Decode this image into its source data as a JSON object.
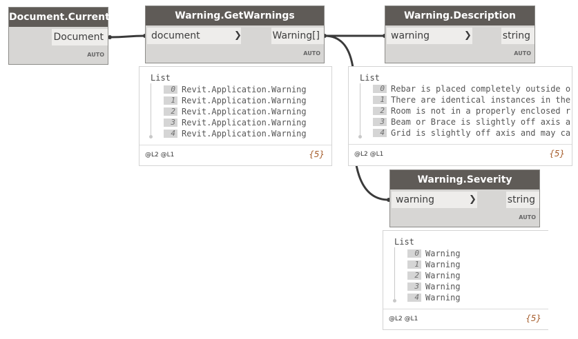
{
  "nodes": {
    "document_current": {
      "title": "Document.Current",
      "output": "Document",
      "lacing": "AUTO"
    },
    "get_warnings": {
      "title": "Warning.GetWarnings",
      "input": "document",
      "output": "Warning[]",
      "lacing": "AUTO"
    },
    "description": {
      "title": "Warning.Description",
      "input": "warning",
      "output": "string",
      "lacing": "AUTO"
    },
    "severity": {
      "title": "Warning.Severity",
      "input": "warning",
      "output": "string",
      "lacing": "AUTO"
    }
  },
  "previews": {
    "get_warnings": {
      "title": "List",
      "items": [
        {
          "index": "0",
          "value": "Revit.Application.Warning"
        },
        {
          "index": "1",
          "value": "Revit.Application.Warning"
        },
        {
          "index": "2",
          "value": "Revit.Application.Warning"
        },
        {
          "index": "3",
          "value": "Revit.Application.Warning"
        },
        {
          "index": "4",
          "value": "Revit.Application.Warning"
        }
      ],
      "levels": "@L2 @L1",
      "count": "{5}"
    },
    "description": {
      "title": "List",
      "items": [
        {
          "index": "0",
          "value": "Rebar is placed completely outside o"
        },
        {
          "index": "1",
          "value": "There are identical instances in the"
        },
        {
          "index": "2",
          "value": "Room is not in a properly enclosed r"
        },
        {
          "index": "3",
          "value": "Beam or Brace is slightly off axis a"
        },
        {
          "index": "4",
          "value": "Grid is slightly off axis and may ca"
        }
      ],
      "levels": "@L2 @L1",
      "count": "{5}"
    },
    "severity": {
      "title": "List",
      "items": [
        {
          "index": "0",
          "value": "Warning"
        },
        {
          "index": "1",
          "value": "Warning"
        },
        {
          "index": "2",
          "value": "Warning"
        },
        {
          "index": "3",
          "value": "Warning"
        },
        {
          "index": "4",
          "value": "Warning"
        }
      ],
      "levels": "@L2 @L1",
      "count": "{5}"
    }
  },
  "colors": {
    "node_header": "#5f5b57",
    "node_body": "#d7d6d4",
    "port": "#eeedeb",
    "wire": "#3a3a3a",
    "count": "#a45a28"
  }
}
